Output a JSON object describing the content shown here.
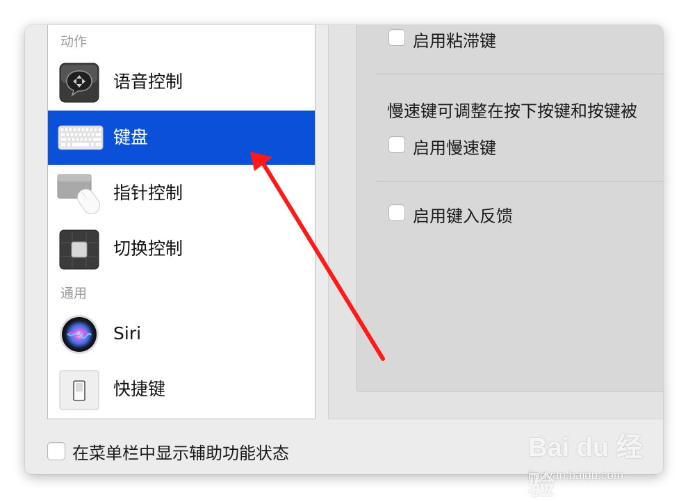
{
  "sidebar": {
    "section_action": "动作",
    "section_general": "通用",
    "items": [
      {
        "label": "语音控制",
        "icon": "voice-control-icon"
      },
      {
        "label": "键盘",
        "icon": "keyboard-icon",
        "selected": true
      },
      {
        "label": "指针控制",
        "icon": "pointer-control-icon"
      },
      {
        "label": "切换控制",
        "icon": "switch-control-icon"
      },
      {
        "label": "Siri",
        "icon": "siri-icon"
      },
      {
        "label": "快捷键",
        "icon": "shortcut-icon"
      }
    ]
  },
  "panel": {
    "sticky_keys_label": "启用粘滞键",
    "slow_keys_desc": "慢速键可调整在按下按键和按键被",
    "slow_keys_label": "启用慢速键",
    "typing_feedback_label": "启用键入反馈"
  },
  "bottom": {
    "show_status_label": "在菜单栏中显示辅助功能状态"
  },
  "watermark": {
    "brand": "Bai du 经验",
    "url": "jingyan.baidu.com"
  },
  "colors": {
    "selection": "#0a50d8",
    "annotation_arrow": "#ff1a1a"
  }
}
